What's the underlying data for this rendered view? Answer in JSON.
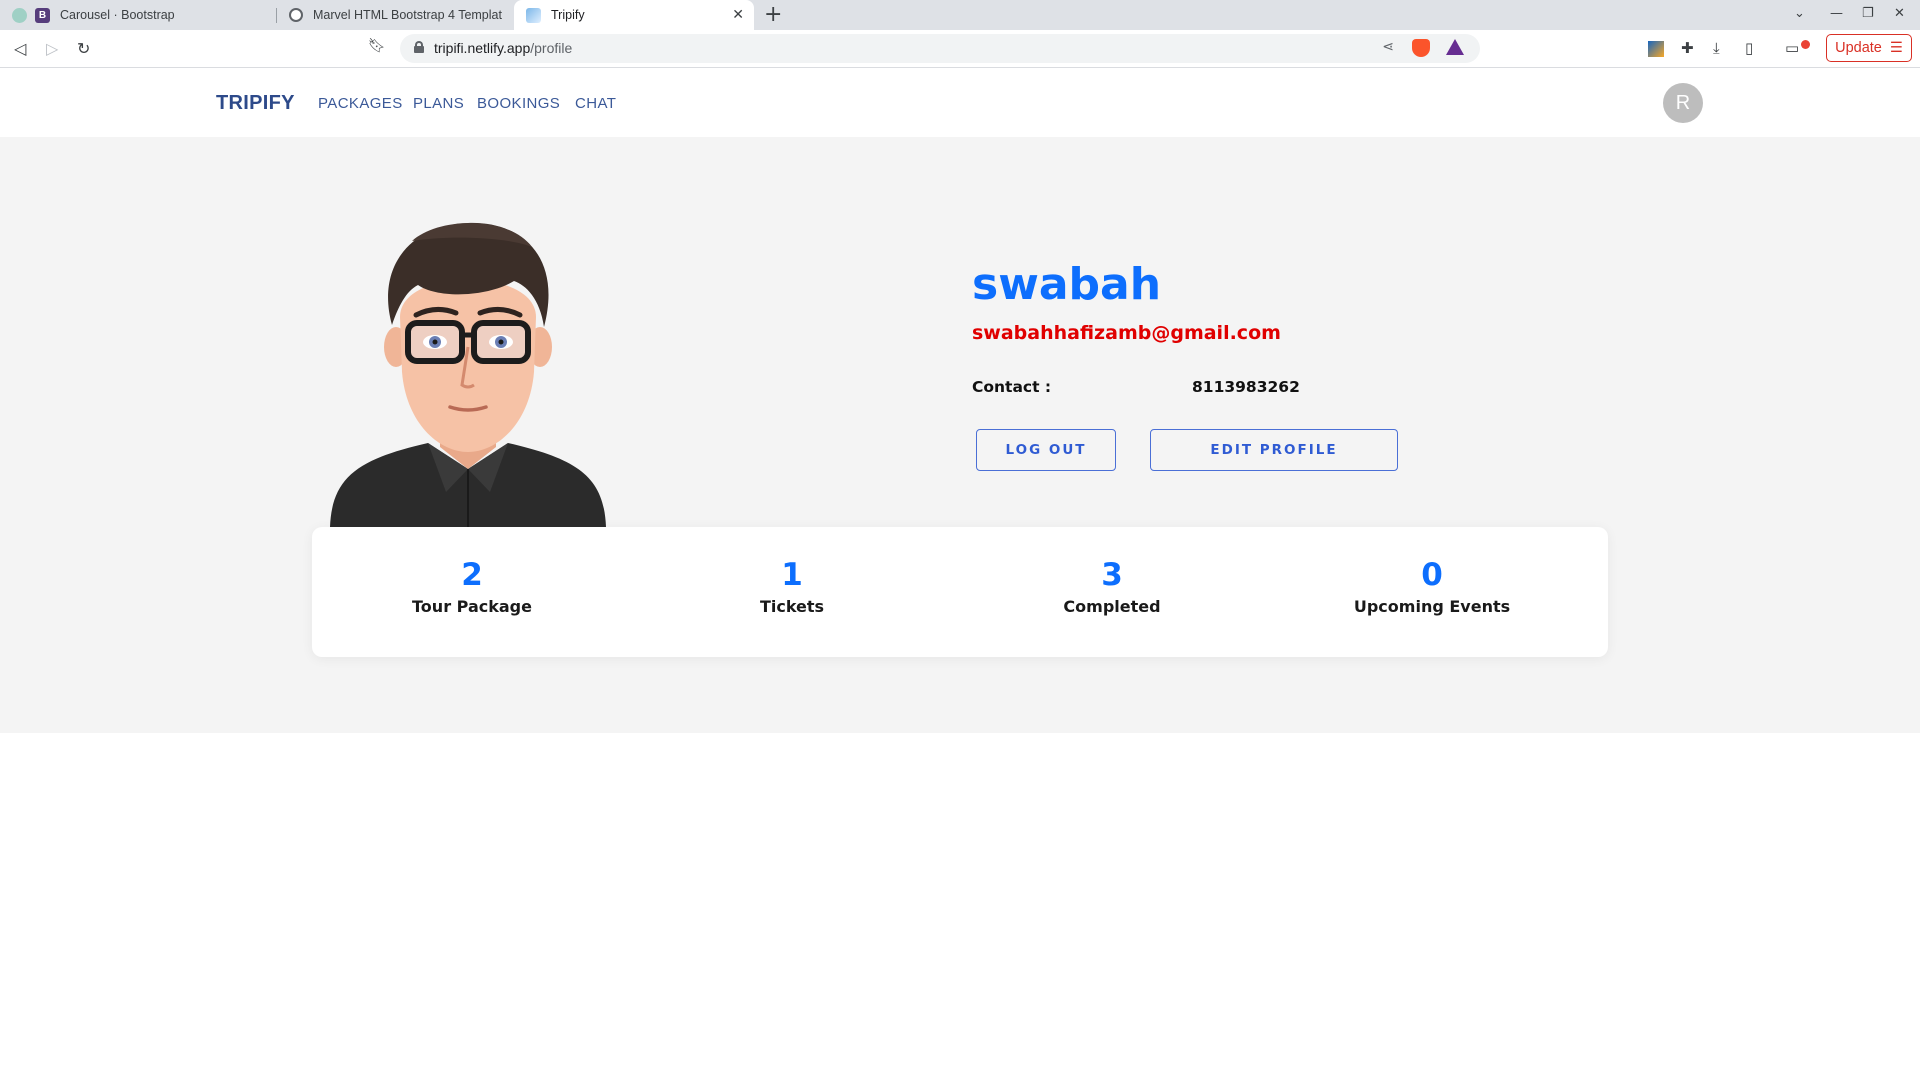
{
  "browser": {
    "tabs": [
      {
        "title": "Carousel · Bootstrap",
        "favicon": "bootstrap-icon",
        "active": false
      },
      {
        "title": "Marvel HTML Bootstrap 4 Templat",
        "favicon": "globe-icon",
        "active": false
      },
      {
        "title": "Tripify",
        "favicon": "tripify-icon",
        "active": true
      }
    ],
    "url_host": "tripifi.netlify.app",
    "url_path": "/profile",
    "update_label": "Update",
    "update_color": "#d93025"
  },
  "site": {
    "brand": "TRIPIFY",
    "nav": [
      "PACKAGES",
      "PLANS",
      "BOOKINGS",
      "CHAT"
    ],
    "user_initial": "R",
    "accent": "#0d6efd",
    "nav_color": "#3b5998"
  },
  "profile": {
    "name": "swabah",
    "email": "swabahhafizamb@gmail.com",
    "contact_label": "Contact :",
    "contact_value": "8113983262",
    "logout_label": "LOG OUT",
    "edit_label": "EDIT PROFILE",
    "email_color": "#e00000"
  },
  "stats": [
    {
      "value": "2",
      "label": "Tour Package"
    },
    {
      "value": "1",
      "label": "Tickets"
    },
    {
      "value": "3",
      "label": "Completed"
    },
    {
      "value": "0",
      "label": "Upcoming Events"
    }
  ]
}
